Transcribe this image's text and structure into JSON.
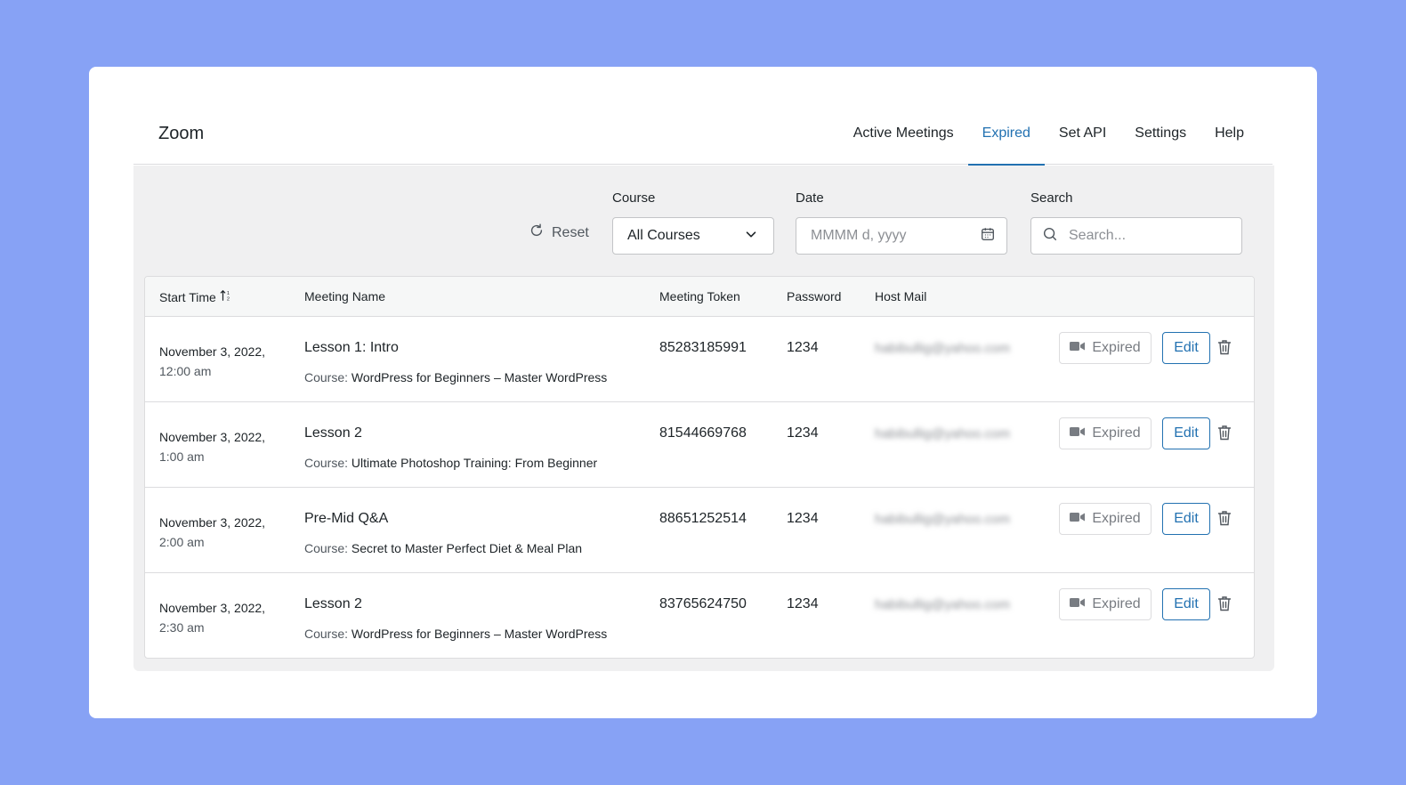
{
  "app": {
    "title": "Zoom"
  },
  "tabs": [
    {
      "label": "Active Meetings",
      "active": false
    },
    {
      "label": "Expired",
      "active": true
    },
    {
      "label": "Set API",
      "active": false
    },
    {
      "label": "Settings",
      "active": false
    },
    {
      "label": "Help",
      "active": false
    }
  ],
  "filters": {
    "reset_label": "Reset",
    "course_label": "Course",
    "course_value": "All Courses",
    "date_label": "Date",
    "date_placeholder": "MMMM d, yyyy",
    "search_label": "Search",
    "search_placeholder": "Search..."
  },
  "table": {
    "headers": {
      "start_time": "Start Time",
      "meeting_name": "Meeting Name",
      "meeting_token": "Meeting Token",
      "password": "Password",
      "host_mail": "Host Mail"
    },
    "course_prefix": "Course:",
    "expired_label": "Expired",
    "edit_label": "Edit",
    "rows": [
      {
        "date": "November 3, 2022,",
        "time": "12:00 am",
        "name": "Lesson 1: Intro",
        "course": "WordPress for Beginners – Master WordPress",
        "token": "85283185991",
        "password": "1234",
        "host_mail": "habibullig@yahoo.com"
      },
      {
        "date": "November 3, 2022,",
        "time": "1:00 am",
        "name": "Lesson 2",
        "course": "Ultimate Photoshop Training: From Beginner",
        "token": "81544669768",
        "password": "1234",
        "host_mail": "habibullig@yahoo.com"
      },
      {
        "date": "November 3, 2022,",
        "time": "2:00 am",
        "name": "Pre-Mid Q&A",
        "course": "Secret to Master Perfect Diet & Meal Plan",
        "token": "88651252514",
        "password": "1234",
        "host_mail": "habibullig@yahoo.com"
      },
      {
        "date": "November 3, 2022,",
        "time": "2:30 am",
        "name": "Lesson 2",
        "course": "WordPress for Beginners – Master WordPress",
        "token": "83765624750",
        "password": "1234",
        "host_mail": "habibullig@yahoo.com"
      }
    ]
  },
  "colors": {
    "background": "#87a2f5",
    "accent": "#2271b1"
  }
}
